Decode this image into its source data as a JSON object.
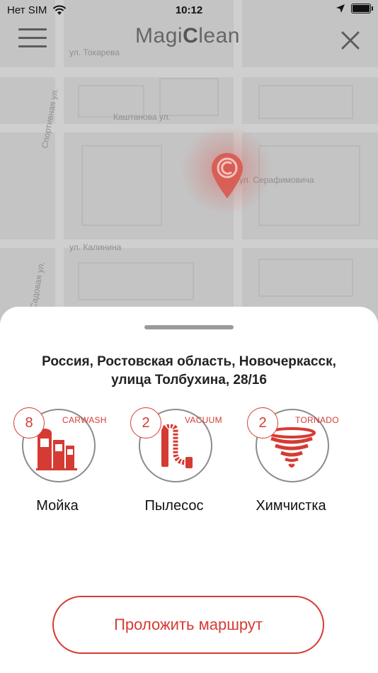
{
  "status_bar": {
    "carrier": "Нет SIM",
    "time": "10:12"
  },
  "header": {
    "logo_start": "Magi",
    "logo_c": "C",
    "logo_end": "lean"
  },
  "map": {
    "streets": [
      {
        "name": "ул. Токарева"
      },
      {
        "name": "Спортивная ул."
      },
      {
        "name": "Каштанова ул."
      },
      {
        "name": "ул. Серафимовича"
      },
      {
        "name": "ул. Калинина"
      },
      {
        "name": "Садовая ул."
      }
    ]
  },
  "sheet": {
    "address_line1": "Россия, Ростовская область, Новочеркасск,",
    "address_line2": "улица Толбухина, 28/16",
    "services": [
      {
        "count": "8",
        "tag": "CARWASH",
        "label": "Мойка",
        "icon": "carwash-icon"
      },
      {
        "count": "2",
        "tag": "VACUUM",
        "label": "Пылесос",
        "icon": "vacuum-icon"
      },
      {
        "count": "2",
        "tag": "TORNADO",
        "label": "Химчистка",
        "icon": "tornado-icon"
      }
    ],
    "route_button": "Проложить маршрут"
  },
  "colors": {
    "accent": "#d53b33",
    "map_bg": "#c4c4c4",
    "sheet_bg": "#ffffff"
  }
}
